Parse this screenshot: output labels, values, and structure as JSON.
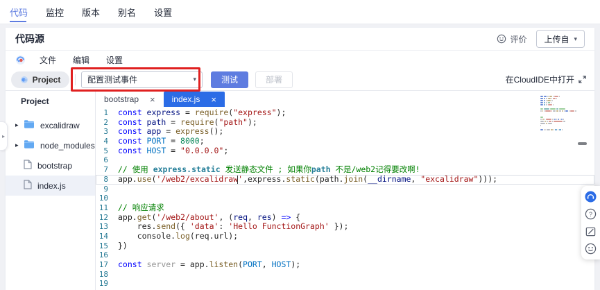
{
  "colors": {
    "accent": "#5e7ce0",
    "active_editor_tab": "#2b6ce6",
    "annotation_red": "#e02020",
    "folder_icon": "#63a9f2",
    "file_icon": "#8a93a3"
  },
  "glyphs": {
    "close": "×",
    "caret_down": "▾",
    "tree_arrow": "▸",
    "collapse_arrow": "▸"
  },
  "topnav": {
    "tabs": [
      {
        "label": "代码",
        "active": true
      },
      {
        "label": "监控",
        "active": false
      },
      {
        "label": "版本",
        "active": false
      },
      {
        "label": "别名",
        "active": false
      },
      {
        "label": "设置",
        "active": false
      }
    ]
  },
  "header": {
    "title": "代码源",
    "rate_label": "评价",
    "upload_button": "上传自"
  },
  "menubar": {
    "items": [
      "文件",
      "编辑",
      "设置"
    ]
  },
  "toolbar": {
    "project_button": "Project",
    "event_select_value": "配置测试事件",
    "test_button": "测试",
    "deploy_button": "部署",
    "open_in_cloudide": "在CloudIDE中打开"
  },
  "sidebar": {
    "title": "Project",
    "tree": [
      {
        "label": "excalidraw",
        "type": "folder",
        "expandable": true,
        "selected": false
      },
      {
        "label": "node_modules",
        "type": "folder",
        "expandable": true,
        "selected": false
      },
      {
        "label": "bootstrap",
        "type": "file",
        "expandable": false,
        "selected": false
      },
      {
        "label": "index.js",
        "type": "file",
        "expandable": false,
        "selected": true
      }
    ]
  },
  "editor": {
    "tabs": [
      {
        "label": "bootstrap",
        "active": false
      },
      {
        "label": "index.js",
        "active": true
      }
    ],
    "code": {
      "lines": [
        {
          "n": 1,
          "seg": [
            {
              "t": "const ",
              "c": "kw"
            },
            {
              "t": "express",
              "c": "var"
            },
            {
              "t": " = ",
              "c": "pl"
            },
            {
              "t": "require",
              "c": "fn"
            },
            {
              "t": "(",
              "c": "pl"
            },
            {
              "t": "\"express\"",
              "c": "str"
            },
            {
              "t": ");",
              "c": "pl"
            }
          ]
        },
        {
          "n": 2,
          "seg": [
            {
              "t": "const ",
              "c": "kw"
            },
            {
              "t": "path",
              "c": "var"
            },
            {
              "t": " = ",
              "c": "pl"
            },
            {
              "t": "require",
              "c": "fn"
            },
            {
              "t": "(",
              "c": "pl"
            },
            {
              "t": "\"path\"",
              "c": "str"
            },
            {
              "t": ");",
              "c": "pl"
            }
          ]
        },
        {
          "n": 3,
          "seg": [
            {
              "t": "const ",
              "c": "kw"
            },
            {
              "t": "app",
              "c": "var"
            },
            {
              "t": " = ",
              "c": "pl"
            },
            {
              "t": "express",
              "c": "fn"
            },
            {
              "t": "();",
              "c": "pl"
            }
          ]
        },
        {
          "n": 4,
          "seg": [
            {
              "t": "const ",
              "c": "kw"
            },
            {
              "t": "PORT",
              "c": "const"
            },
            {
              "t": " = ",
              "c": "pl"
            },
            {
              "t": "8000",
              "c": "num"
            },
            {
              "t": ";",
              "c": "pl"
            }
          ]
        },
        {
          "n": 5,
          "seg": [
            {
              "t": "const ",
              "c": "kw"
            },
            {
              "t": "HOST",
              "c": "const"
            },
            {
              "t": " = ",
              "c": "pl"
            },
            {
              "t": "\"0.0.0.0\"",
              "c": "str"
            },
            {
              "t": ";",
              "c": "pl"
            }
          ]
        },
        {
          "n": 6,
          "seg": []
        },
        {
          "n": 7,
          "seg": [
            {
              "t": "// 使用 ",
              "c": "cm"
            },
            {
              "t": "express.static",
              "c": "cmc"
            },
            {
              "t": " 发送静态文件 ; 如果你",
              "c": "cm"
            },
            {
              "t": "path",
              "c": "cmc"
            },
            {
              "t": " 不是/web2记得要改啊!",
              "c": "cm"
            }
          ]
        },
        {
          "n": 8,
          "current": true,
          "seg": [
            {
              "t": "app.",
              "c": "pl"
            },
            {
              "t": "use",
              "c": "fn"
            },
            {
              "t": "(",
              "c": "pl"
            },
            {
              "t": "'/web2/excalidraw",
              "c": "str"
            },
            {
              "t": "",
              "c": "cursor"
            },
            {
              "t": "'",
              "c": "str"
            },
            {
              "t": ",express.",
              "c": "pl"
            },
            {
              "t": "static",
              "c": "fn"
            },
            {
              "t": "(path.",
              "c": "pl"
            },
            {
              "t": "join",
              "c": "fn"
            },
            {
              "t": "(",
              "c": "pl"
            },
            {
              "t": "__dirname",
              "c": "var"
            },
            {
              "t": ", ",
              "c": "pl"
            },
            {
              "t": "\"excalidraw\"",
              "c": "str"
            },
            {
              "t": ")));",
              "c": "pl"
            }
          ]
        },
        {
          "n": 9,
          "seg": []
        },
        {
          "n": 10,
          "seg": []
        },
        {
          "n": 11,
          "seg": [
            {
              "t": "// 响应请求",
              "c": "cm"
            }
          ]
        },
        {
          "n": 12,
          "seg": [
            {
              "t": "app.",
              "c": "pl"
            },
            {
              "t": "get",
              "c": "fn"
            },
            {
              "t": "(",
              "c": "pl"
            },
            {
              "t": "'/web2/about'",
              "c": "str"
            },
            {
              "t": ", (",
              "c": "pl"
            },
            {
              "t": "req",
              "c": "var"
            },
            {
              "t": ", ",
              "c": "pl"
            },
            {
              "t": "res",
              "c": "var"
            },
            {
              "t": ") ",
              "c": "pl"
            },
            {
              "t": "=>",
              "c": "kw"
            },
            {
              "t": " {",
              "c": "pl"
            }
          ]
        },
        {
          "n": 13,
          "seg": [
            {
              "t": "    res.",
              "c": "pl"
            },
            {
              "t": "send",
              "c": "fn"
            },
            {
              "t": "({ ",
              "c": "pl"
            },
            {
              "t": "'data'",
              "c": "str"
            },
            {
              "t": ": ",
              "c": "pl"
            },
            {
              "t": "'Hello FunctionGraph'",
              "c": "str"
            },
            {
              "t": " });",
              "c": "pl"
            }
          ]
        },
        {
          "n": 14,
          "seg": [
            {
              "t": "    console.",
              "c": "pl"
            },
            {
              "t": "log",
              "c": "fn"
            },
            {
              "t": "(req.url);",
              "c": "pl"
            }
          ]
        },
        {
          "n": 15,
          "seg": [
            {
              "t": "})",
              "c": "pl"
            }
          ]
        },
        {
          "n": 16,
          "seg": []
        },
        {
          "n": 17,
          "seg": [
            {
              "t": "const ",
              "c": "kw"
            },
            {
              "t": "server",
              "c": "gray"
            },
            {
              "t": " = app.",
              "c": "pl"
            },
            {
              "t": "listen",
              "c": "fn"
            },
            {
              "t": "(",
              "c": "pl"
            },
            {
              "t": "PORT",
              "c": "const"
            },
            {
              "t": ", ",
              "c": "pl"
            },
            {
              "t": "HOST",
              "c": "const"
            },
            {
              "t": ");",
              "c": "pl"
            }
          ]
        },
        {
          "n": 18,
          "seg": []
        },
        {
          "n": 19,
          "seg": []
        }
      ]
    }
  },
  "help_panel": {
    "icons": [
      "support-icon",
      "help-icon",
      "feedback-icon",
      "smiley-icon"
    ]
  }
}
